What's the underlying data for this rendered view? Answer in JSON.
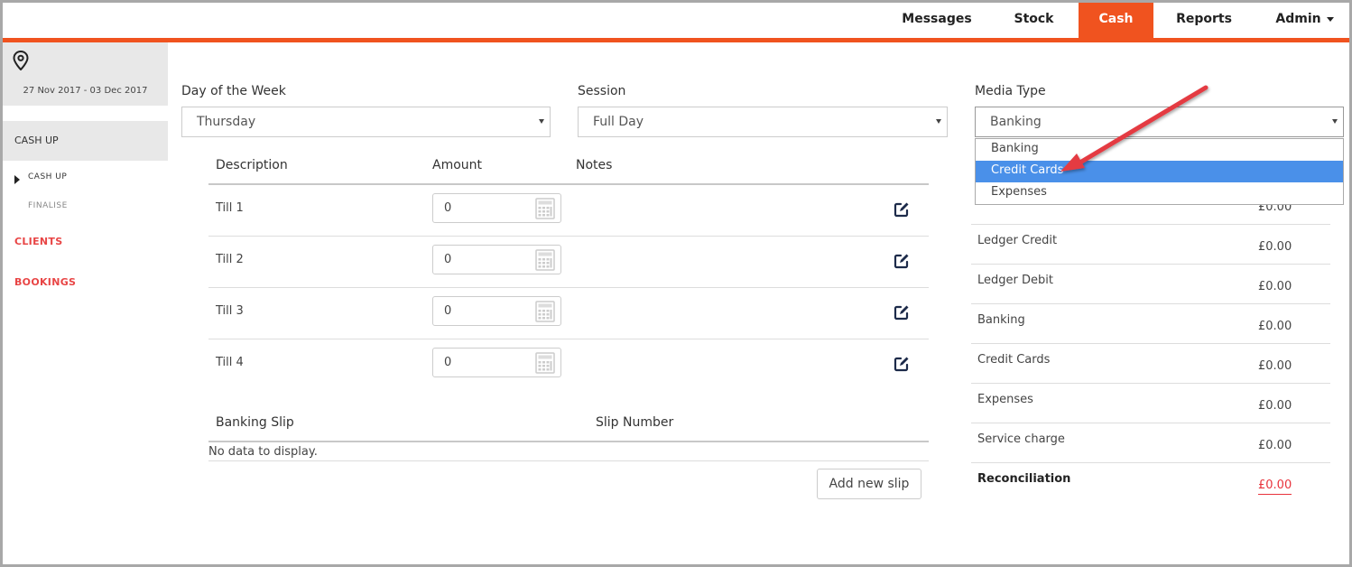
{
  "nav": {
    "items": [
      {
        "label": "Messages"
      },
      {
        "label": "Stock"
      },
      {
        "label": "Cash"
      },
      {
        "label": "Reports"
      },
      {
        "label": "Admin"
      }
    ],
    "active": "Cash",
    "accent_color": "#f0531f"
  },
  "sidebar": {
    "date_range": "27 Nov 2017 - 03 Dec 2017",
    "section": "CASH UP",
    "sub_items": [
      {
        "label": "CASH UP",
        "active": true
      },
      {
        "label": "FINALISE",
        "active": false
      }
    ],
    "links": [
      {
        "label": "CLIENTS"
      },
      {
        "label": "BOOKINGS"
      }
    ],
    "link_color": "#e84545"
  },
  "form": {
    "day_label": "Day of the Week",
    "day_value": "Thursday",
    "session_label": "Session",
    "session_value": "Full Day",
    "media_label": "Media Type",
    "media_value": "Banking",
    "media_options": [
      {
        "label": "Banking",
        "selected": false
      },
      {
        "label": "Credit Cards",
        "selected": true
      },
      {
        "label": "Expenses",
        "selected": false
      }
    ]
  },
  "tills_table": {
    "headers": {
      "description": "Description",
      "amount": "Amount",
      "notes": "Notes"
    },
    "rows": [
      {
        "description": "Till 1",
        "amount": "0"
      },
      {
        "description": "Till 2",
        "amount": "0"
      },
      {
        "description": "Till 3",
        "amount": "0"
      },
      {
        "description": "Till 4",
        "amount": "0"
      }
    ]
  },
  "slips_table": {
    "headers": {
      "banking_slip": "Banking Slip",
      "slip_number": "Slip Number"
    },
    "empty_text": "No data to display.",
    "add_button": "Add new slip"
  },
  "summary": {
    "first_value": "£0.00",
    "rows": [
      {
        "label": "Ledger Credit",
        "value": "£0.00"
      },
      {
        "label": "Ledger Debit",
        "value": "£0.00"
      },
      {
        "label": "Banking",
        "value": "£0.00"
      },
      {
        "label": "Credit Cards",
        "value": "£0.00"
      },
      {
        "label": "Expenses",
        "value": "£0.00"
      },
      {
        "label": "Service charge",
        "value": "£0.00"
      }
    ],
    "reconciliation_label": "Reconciliation",
    "reconciliation_value": "£0.00",
    "alert_color": "#e8333c"
  }
}
